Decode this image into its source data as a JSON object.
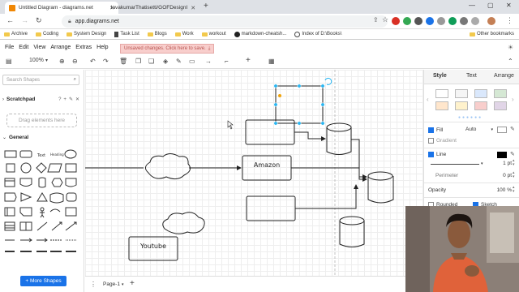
{
  "browser": {
    "tabs": [
      {
        "title": "Untitled Diagram - diagrams.net"
      },
      {
        "title": "lavakumarThatisetti/GOFDesignI"
      }
    ],
    "new_tab": "+",
    "url": "app.diagrams.net",
    "bookmarks": [
      "Archive",
      "Coding",
      "System Design",
      "Task List",
      "Blogs",
      "Work",
      "workout",
      "markdown-cheatsh...",
      "Index of D:\\Books\\",
      "Other bookmarks"
    ]
  },
  "app": {
    "menus": [
      "File",
      "Edit",
      "View",
      "Arrange",
      "Extras",
      "Help"
    ],
    "unsaved": "Unsaved changes. Click here to save.",
    "zoom": "100%"
  },
  "left_panel": {
    "search_placeholder": "Search Shapes",
    "scratchpad": "Scratchpad",
    "scratchpad_actions": [
      "?",
      "+",
      "✎",
      "✕"
    ],
    "drag_here": "Drag elements here",
    "general": "General",
    "more_shapes": "+ More Shapes"
  },
  "canvas": {
    "shapes": [
      {
        "label": "Amazon"
      },
      {
        "label": "Youtube"
      }
    ]
  },
  "pages": {
    "page_tab": "Page-1",
    "add_page": "+"
  },
  "right_panel": {
    "tabs": [
      "Style",
      "Text",
      "Arrange"
    ],
    "fill_label": "Fill",
    "fill_mode": "Auto",
    "gradient_label": "Gradient",
    "line_label": "Line",
    "line_width": "1 pt",
    "perimeter_label": "Perimeter",
    "perimeter_value": "0 pt",
    "opacity_label": "Opacity",
    "opacity_value": "100 %",
    "rounded_label": "Rounded",
    "sketch_label": "Sketch",
    "swatches": [
      "#ffffff",
      "#f5f5f5",
      "#dae8fc",
      "#d5e8d4",
      "#ffe6cc",
      "#fff2cc",
      "#f8cecc",
      "#e1d5e7"
    ]
  }
}
